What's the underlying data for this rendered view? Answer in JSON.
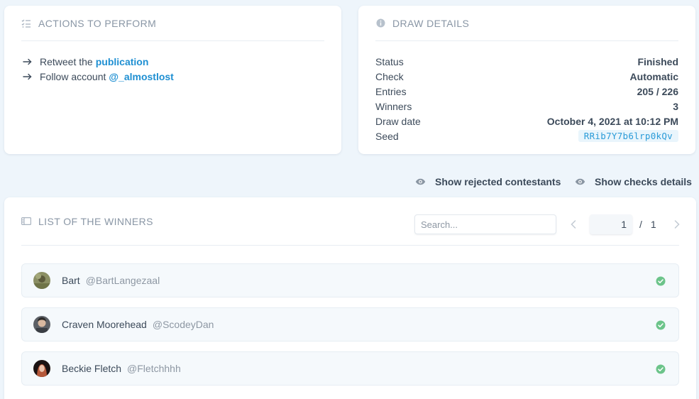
{
  "actions": {
    "title": "Actions to perform",
    "items": [
      {
        "prefix": "Retweet the",
        "link": "publication"
      },
      {
        "prefix": "Follow account",
        "link": "@_almostlost"
      }
    ]
  },
  "details": {
    "title": "Draw details",
    "rows": [
      {
        "key": "Status",
        "value": "Finished"
      },
      {
        "key": "Check",
        "value": "Automatic"
      },
      {
        "key": "Entries",
        "value": "205 / 226"
      },
      {
        "key": "Winners",
        "value": "3"
      },
      {
        "key": "Draw date",
        "value": "October 4, 2021 at 10:12 PM"
      }
    ],
    "seed_label": "Seed",
    "seed_value": "RRib7Y7b6lrp0kQv"
  },
  "toggles": {
    "rejected": "Show rejected contestants",
    "checks": "Show checks details"
  },
  "winners": {
    "title": "List of the winners",
    "search_placeholder": "Search...",
    "page_current": "1",
    "page_sep": "/",
    "page_total": "1",
    "list": [
      {
        "name": "Bart",
        "handle": "@BartLangezaal"
      },
      {
        "name": "Craven Moorehead",
        "handle": "@ScodeyDan"
      },
      {
        "name": "Beckie Fletch",
        "handle": "@Fletchhhh"
      }
    ]
  },
  "colors": {
    "accent": "#1e8fd2",
    "check_green": "#6cc48a",
    "background": "#eef5fb"
  }
}
